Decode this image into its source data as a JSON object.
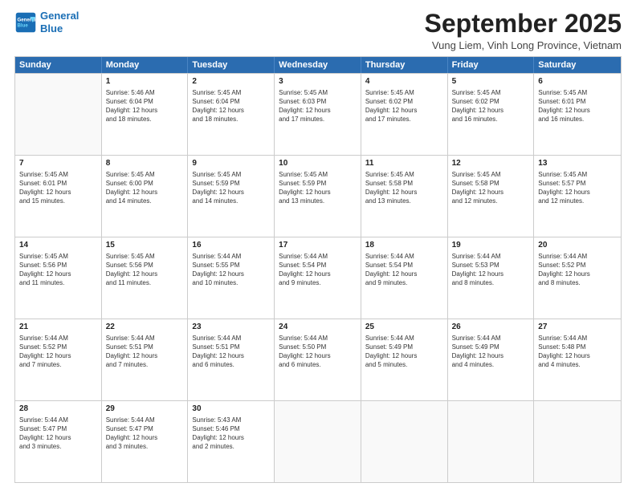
{
  "logo": {
    "line1": "General",
    "line2": "Blue"
  },
  "title": "September 2025",
  "location": "Vung Liem, Vinh Long Province, Vietnam",
  "weekdays": [
    "Sunday",
    "Monday",
    "Tuesday",
    "Wednesday",
    "Thursday",
    "Friday",
    "Saturday"
  ],
  "rows": [
    [
      {
        "day": "",
        "info": ""
      },
      {
        "day": "1",
        "info": "Sunrise: 5:46 AM\nSunset: 6:04 PM\nDaylight: 12 hours\nand 18 minutes."
      },
      {
        "day": "2",
        "info": "Sunrise: 5:45 AM\nSunset: 6:04 PM\nDaylight: 12 hours\nand 18 minutes."
      },
      {
        "day": "3",
        "info": "Sunrise: 5:45 AM\nSunset: 6:03 PM\nDaylight: 12 hours\nand 17 minutes."
      },
      {
        "day": "4",
        "info": "Sunrise: 5:45 AM\nSunset: 6:02 PM\nDaylight: 12 hours\nand 17 minutes."
      },
      {
        "day": "5",
        "info": "Sunrise: 5:45 AM\nSunset: 6:02 PM\nDaylight: 12 hours\nand 16 minutes."
      },
      {
        "day": "6",
        "info": "Sunrise: 5:45 AM\nSunset: 6:01 PM\nDaylight: 12 hours\nand 16 minutes."
      }
    ],
    [
      {
        "day": "7",
        "info": "Sunrise: 5:45 AM\nSunset: 6:01 PM\nDaylight: 12 hours\nand 15 minutes."
      },
      {
        "day": "8",
        "info": "Sunrise: 5:45 AM\nSunset: 6:00 PM\nDaylight: 12 hours\nand 14 minutes."
      },
      {
        "day": "9",
        "info": "Sunrise: 5:45 AM\nSunset: 5:59 PM\nDaylight: 12 hours\nand 14 minutes."
      },
      {
        "day": "10",
        "info": "Sunrise: 5:45 AM\nSunset: 5:59 PM\nDaylight: 12 hours\nand 13 minutes."
      },
      {
        "day": "11",
        "info": "Sunrise: 5:45 AM\nSunset: 5:58 PM\nDaylight: 12 hours\nand 13 minutes."
      },
      {
        "day": "12",
        "info": "Sunrise: 5:45 AM\nSunset: 5:58 PM\nDaylight: 12 hours\nand 12 minutes."
      },
      {
        "day": "13",
        "info": "Sunrise: 5:45 AM\nSunset: 5:57 PM\nDaylight: 12 hours\nand 12 minutes."
      }
    ],
    [
      {
        "day": "14",
        "info": "Sunrise: 5:45 AM\nSunset: 5:56 PM\nDaylight: 12 hours\nand 11 minutes."
      },
      {
        "day": "15",
        "info": "Sunrise: 5:45 AM\nSunset: 5:56 PM\nDaylight: 12 hours\nand 11 minutes."
      },
      {
        "day": "16",
        "info": "Sunrise: 5:44 AM\nSunset: 5:55 PM\nDaylight: 12 hours\nand 10 minutes."
      },
      {
        "day": "17",
        "info": "Sunrise: 5:44 AM\nSunset: 5:54 PM\nDaylight: 12 hours\nand 9 minutes."
      },
      {
        "day": "18",
        "info": "Sunrise: 5:44 AM\nSunset: 5:54 PM\nDaylight: 12 hours\nand 9 minutes."
      },
      {
        "day": "19",
        "info": "Sunrise: 5:44 AM\nSunset: 5:53 PM\nDaylight: 12 hours\nand 8 minutes."
      },
      {
        "day": "20",
        "info": "Sunrise: 5:44 AM\nSunset: 5:52 PM\nDaylight: 12 hours\nand 8 minutes."
      }
    ],
    [
      {
        "day": "21",
        "info": "Sunrise: 5:44 AM\nSunset: 5:52 PM\nDaylight: 12 hours\nand 7 minutes."
      },
      {
        "day": "22",
        "info": "Sunrise: 5:44 AM\nSunset: 5:51 PM\nDaylight: 12 hours\nand 7 minutes."
      },
      {
        "day": "23",
        "info": "Sunrise: 5:44 AM\nSunset: 5:51 PM\nDaylight: 12 hours\nand 6 minutes."
      },
      {
        "day": "24",
        "info": "Sunrise: 5:44 AM\nSunset: 5:50 PM\nDaylight: 12 hours\nand 6 minutes."
      },
      {
        "day": "25",
        "info": "Sunrise: 5:44 AM\nSunset: 5:49 PM\nDaylight: 12 hours\nand 5 minutes."
      },
      {
        "day": "26",
        "info": "Sunrise: 5:44 AM\nSunset: 5:49 PM\nDaylight: 12 hours\nand 4 minutes."
      },
      {
        "day": "27",
        "info": "Sunrise: 5:44 AM\nSunset: 5:48 PM\nDaylight: 12 hours\nand 4 minutes."
      }
    ],
    [
      {
        "day": "28",
        "info": "Sunrise: 5:44 AM\nSunset: 5:47 PM\nDaylight: 12 hours\nand 3 minutes."
      },
      {
        "day": "29",
        "info": "Sunrise: 5:44 AM\nSunset: 5:47 PM\nDaylight: 12 hours\nand 3 minutes."
      },
      {
        "day": "30",
        "info": "Sunrise: 5:43 AM\nSunset: 5:46 PM\nDaylight: 12 hours\nand 2 minutes."
      },
      {
        "day": "",
        "info": ""
      },
      {
        "day": "",
        "info": ""
      },
      {
        "day": "",
        "info": ""
      },
      {
        "day": "",
        "info": ""
      }
    ]
  ]
}
